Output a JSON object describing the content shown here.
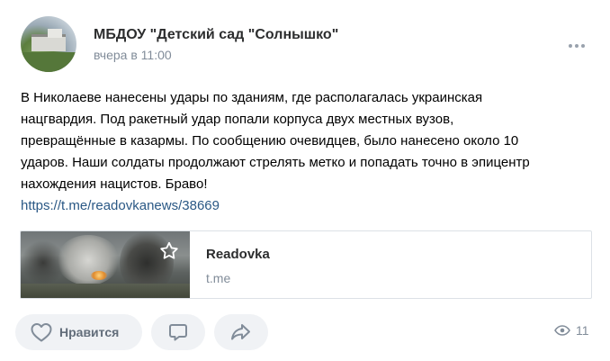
{
  "post": {
    "group_name": "МБДОУ \"Детский сад \"Солнышко\"",
    "time": "вчера в 11:00",
    "text_lines": [
      "В Николаеве нанесены удары по зданиям, где располагалась украинская",
      "нацгвардия. Под ракетный удар попали корпуса двух местных вузов,",
      "превращённые в казармы. По сообщению очевидцев, было нанесено около 10",
      "ударов. Наши солдаты продолжают стрелять метко и попадать точно в эпицентр",
      "нахождения нацистов. Браво!"
    ],
    "link": "https://t.me/readovkanews/38669"
  },
  "attachment": {
    "title": "Readovka",
    "domain": "t.me"
  },
  "actions": {
    "like_label": "Нравится",
    "views": "11"
  },
  "icons": {
    "more": "more-horizontal-icon",
    "star": "star-icon",
    "like": "heart-icon",
    "comment": "comment-icon",
    "share": "share-icon",
    "views": "eye-icon"
  },
  "colors": {
    "link": "#2a5885",
    "secondary_text": "#818c99",
    "button_bg": "#f0f2f5"
  }
}
